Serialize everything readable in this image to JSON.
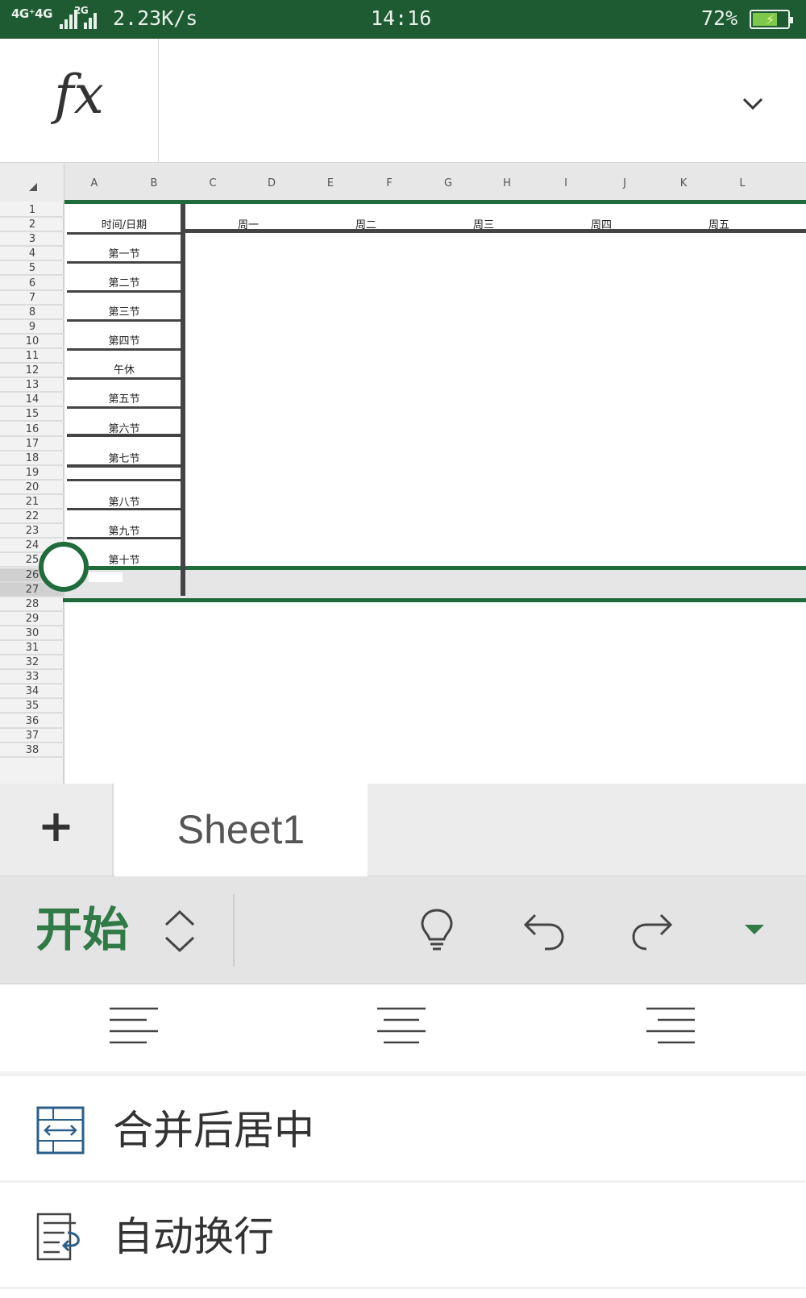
{
  "status_bar": {
    "network": "4G⁺4G",
    "network2": "2G",
    "speed": "2.23K/s",
    "time": "14:16",
    "battery": "72%",
    "battery_level": 0.72
  },
  "formula_bar": {
    "fx_label": "fx",
    "value": "",
    "expand_icon": "chevron-down-icon"
  },
  "grid": {
    "columns": [
      "A",
      "B",
      "C",
      "D",
      "E",
      "F",
      "G",
      "H",
      "I",
      "J",
      "K",
      "L"
    ],
    "rows": [
      "1",
      "2",
      "3",
      "4",
      "5",
      "6",
      "7",
      "8",
      "9",
      "10",
      "11",
      "12",
      "13",
      "14",
      "15",
      "16",
      "17",
      "18",
      "19",
      "20",
      "21",
      "22",
      "23",
      "24",
      "25",
      "26",
      "27",
      "28",
      "29",
      "30",
      "31",
      "32",
      "33",
      "34",
      "35",
      "36",
      "37",
      "38"
    ],
    "selected_rows": [
      "26",
      "27"
    ],
    "header_cell": "时间/日期",
    "days": [
      "周一",
      "周二",
      "周三",
      "周四",
      "周五"
    ],
    "periods": [
      "第一节",
      "第二节",
      "第三节",
      "第四节",
      "午休",
      "第五节",
      "第六节",
      "第七节",
      "第八节",
      "第九节",
      "第十节"
    ]
  },
  "sheet_tabs": {
    "add_label": "+",
    "tabs": [
      "Sheet1"
    ]
  },
  "ribbon": {
    "title": "开始",
    "icons": [
      "updown-icon",
      "lightbulb-icon",
      "undo-icon",
      "redo-icon",
      "more-dropdown-icon"
    ],
    "accent": "#2f7a46"
  },
  "format_panel": {
    "align_icons": [
      "align-left-icon",
      "align-center-icon",
      "align-right-icon"
    ],
    "items": [
      {
        "label": "合并后居中",
        "icon": "merge-center-icon"
      },
      {
        "label": "自动换行",
        "icon": "wrap-text-icon"
      }
    ]
  }
}
